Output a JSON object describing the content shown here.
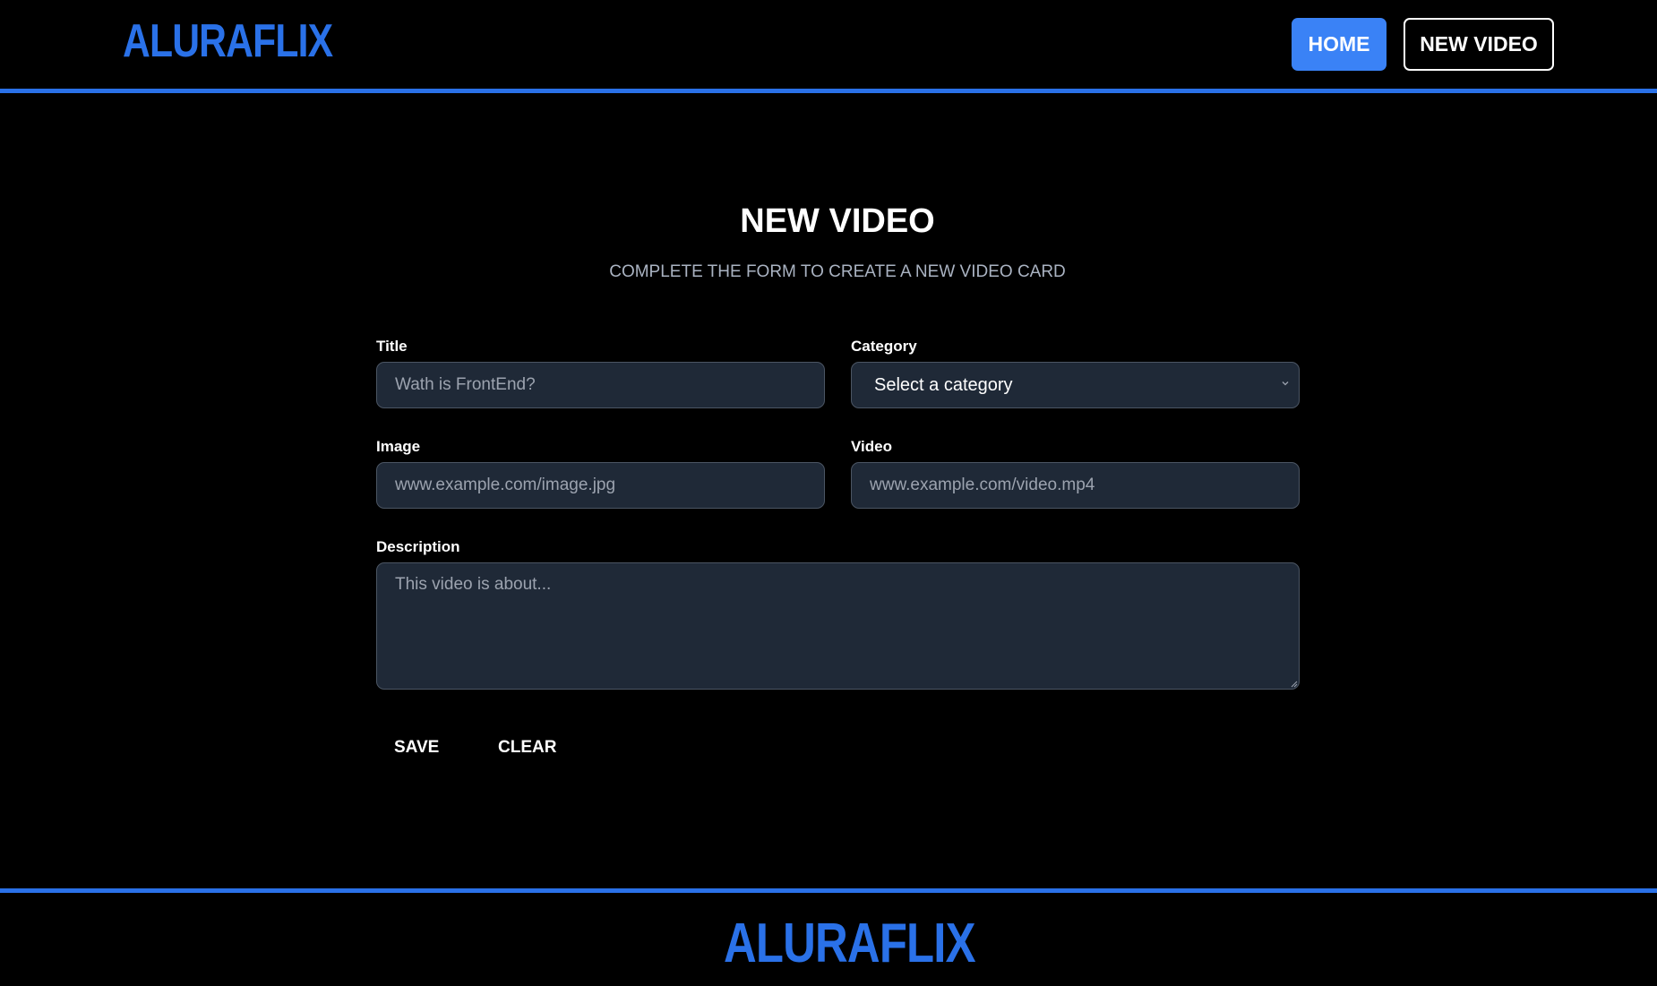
{
  "header": {
    "logo": "ALURAFLIX",
    "nav": {
      "home_label": "HOME",
      "new_video_label": "NEW VIDEO"
    }
  },
  "main": {
    "title": "NEW VIDEO",
    "subtitle": "COMPLETE THE FORM TO CREATE A NEW VIDEO CARD",
    "form": {
      "title_label": "Title",
      "title_placeholder": "Wath is FrontEnd?",
      "category_label": "Category",
      "category_selected": "Select a category",
      "image_label": "Image",
      "image_placeholder": "www.example.com/image.jpg",
      "video_label": "Video",
      "video_placeholder": "www.example.com/video.mp4",
      "description_label": "Description",
      "description_placeholder": "This video is about...",
      "save_label": "SAVE",
      "clear_label": "CLEAR"
    }
  },
  "footer": {
    "logo": "ALURAFLIX"
  },
  "colors": {
    "brand": "#2a71e8",
    "primary_button": "#3a82f6",
    "field_background": "#1f2937",
    "background": "#000000"
  },
  "icons": {
    "select_chevron": "chevron-down-icon",
    "textarea_resize": "resize-handle-icon"
  }
}
